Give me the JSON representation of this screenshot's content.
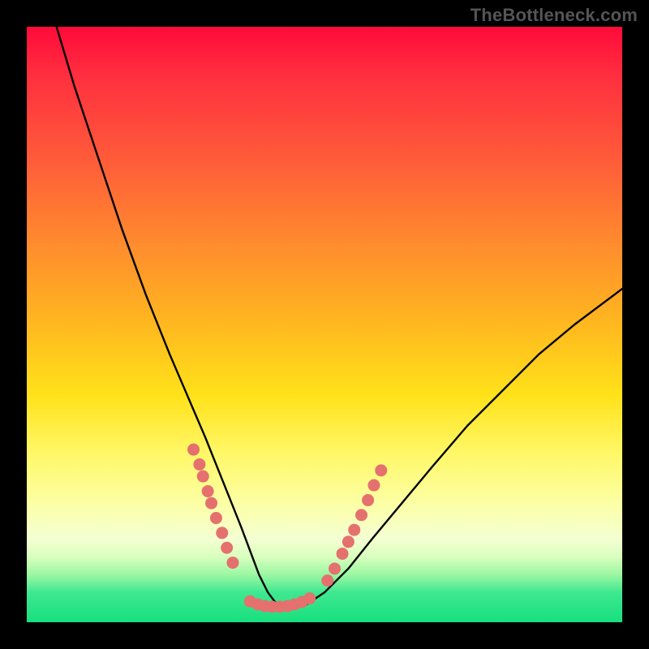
{
  "watermark": "TheBottleneck.com",
  "colors": {
    "page_bg": "#000000",
    "gradient_top": "#ff0a3a",
    "gradient_bottom": "#17e07e",
    "curve_stroke": "#000000",
    "dot_fill": "#e4716e"
  },
  "chart_data": {
    "type": "line",
    "title": "",
    "xlabel": "",
    "ylabel": "",
    "xlim": [
      0,
      100
    ],
    "ylim": [
      0,
      100
    ],
    "grid": false,
    "series": [
      {
        "name": "bottleneck-curve",
        "x": [
          5,
          8,
          12,
          16,
          20,
          24,
          27,
          30,
          32,
          34,
          36,
          37.5,
          39,
          40.5,
          42,
          44,
          47,
          50,
          54,
          58,
          63,
          68,
          74,
          80,
          86,
          92,
          100
        ],
        "y": [
          100,
          90,
          78,
          66,
          55,
          45,
          38,
          31,
          26,
          21,
          16,
          12,
          8,
          5,
          3,
          2.5,
          3,
          5,
          9,
          14,
          20,
          26,
          33,
          39,
          45,
          50,
          56
        ]
      }
    ],
    "scatter": {
      "name": "sample-dots",
      "points": [
        [
          28,
          29
        ],
        [
          29,
          26.5
        ],
        [
          29.6,
          24.5
        ],
        [
          30.4,
          22
        ],
        [
          31,
          20
        ],
        [
          31.8,
          17.5
        ],
        [
          32.8,
          15
        ],
        [
          33.6,
          12.5
        ],
        [
          34.6,
          10
        ],
        [
          37.5,
          3.5
        ],
        [
          38.8,
          3
        ],
        [
          40,
          2.7
        ],
        [
          41.2,
          2.6
        ],
        [
          42.5,
          2.6
        ],
        [
          43.8,
          2.7
        ],
        [
          45,
          3
        ],
        [
          46.2,
          3.4
        ],
        [
          47.5,
          4
        ],
        [
          50.5,
          7
        ],
        [
          51.7,
          9
        ],
        [
          53,
          11.5
        ],
        [
          54,
          13.5
        ],
        [
          55,
          15.5
        ],
        [
          56.2,
          18
        ],
        [
          57.3,
          20.5
        ],
        [
          58.3,
          23
        ],
        [
          59.5,
          25.5
        ]
      ]
    }
  }
}
